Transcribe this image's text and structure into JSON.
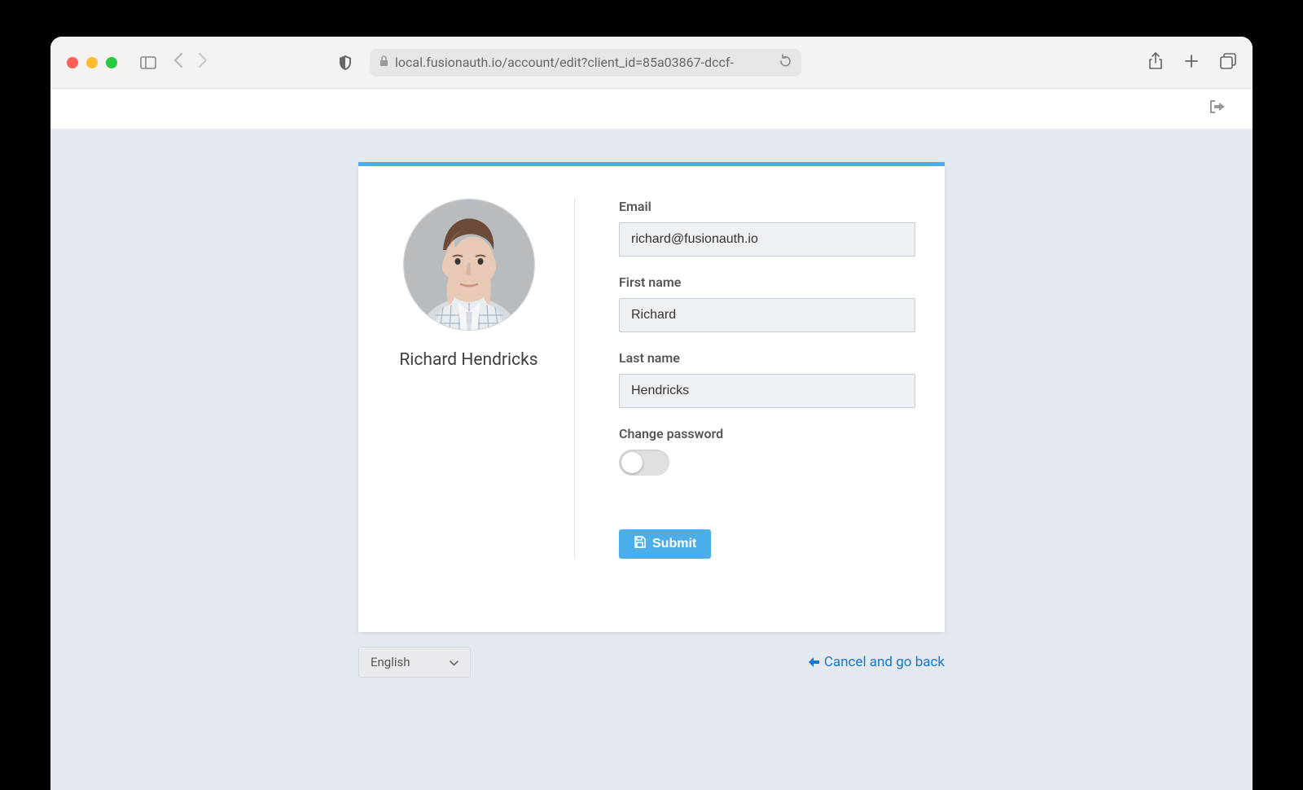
{
  "browser": {
    "url": "local.fusionauth.io/account/edit?client_id=85a03867-dccf-"
  },
  "profile": {
    "display_name": "Richard Hendricks"
  },
  "form": {
    "email_label": "Email",
    "email_value": "richard@fusionauth.io",
    "first_name_label": "First name",
    "first_name_value": "Richard",
    "last_name_label": "Last name",
    "last_name_value": "Hendricks",
    "change_password_label": "Change password",
    "change_password_enabled": false,
    "submit_label": "Submit"
  },
  "footer": {
    "language": "English",
    "cancel_label": "Cancel and go back"
  },
  "colors": {
    "accent": "#4caee8",
    "link": "#1976d2",
    "page_bg": "#e4e9ef"
  }
}
